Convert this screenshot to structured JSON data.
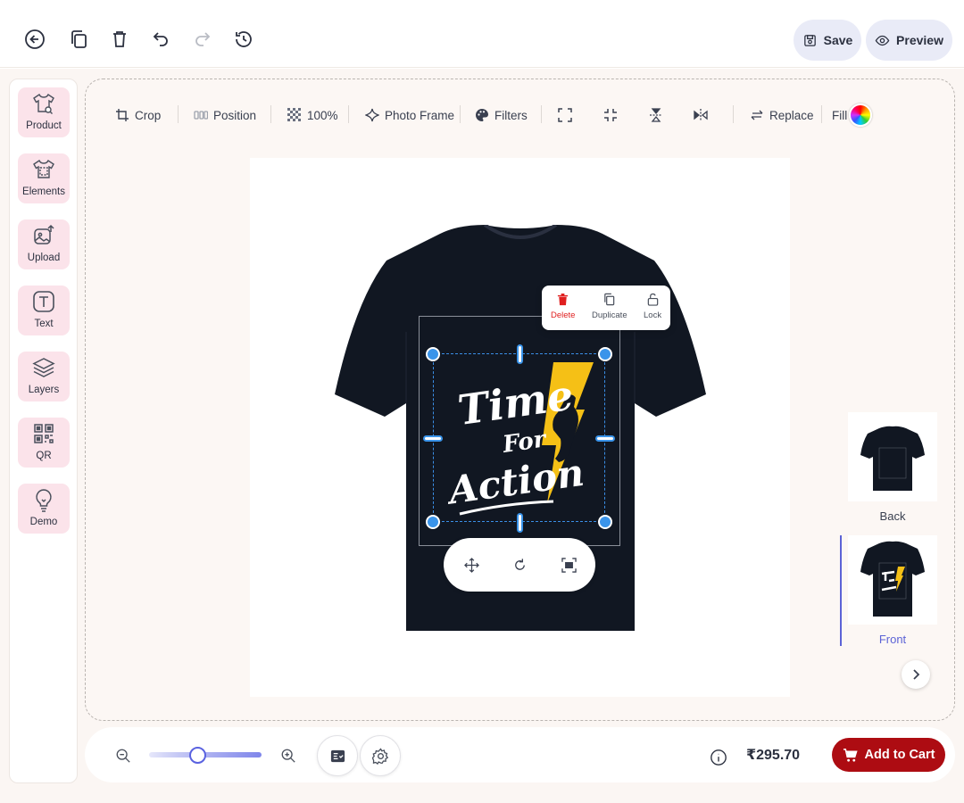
{
  "topbar": {
    "save_label": "Save",
    "preview_label": "Preview",
    "icons": [
      "back-icon",
      "copy-icon",
      "delete-icon",
      "undo-icon",
      "redo-icon",
      "history-icon"
    ]
  },
  "sidebar": {
    "items": [
      {
        "label": "Product",
        "icon": "tshirt-icon"
      },
      {
        "label": "Elements",
        "icon": "elements-icon"
      },
      {
        "label": "Upload",
        "icon": "upload-icon"
      },
      {
        "label": "Text",
        "icon": "text-icon"
      },
      {
        "label": "Layers",
        "icon": "layers-icon"
      },
      {
        "label": "QR",
        "icon": "qr-icon"
      },
      {
        "label": "Demo",
        "icon": "lightbulb-icon"
      }
    ]
  },
  "toolbar": {
    "crop": "Crop",
    "position": "Position",
    "opacity": "100%",
    "photo_frame": "Photo Frame",
    "filters": "Filters",
    "replace": "Replace",
    "fill": "Fill"
  },
  "context_menu": {
    "delete": "Delete",
    "duplicate": "Duplicate",
    "lock": "Lock"
  },
  "design": {
    "line1": "Time",
    "line2": "For",
    "line3": "Action"
  },
  "views": {
    "back": "Back",
    "front": "Front"
  },
  "bottombar": {
    "price": "₹295.70",
    "add_to_cart": "Add to Cart",
    "zoom_level": 0.4
  },
  "colors": {
    "accent": "#5c63d6",
    "cart": "#ad0c12",
    "delete": "#e02020",
    "handle": "#3a94ea",
    "shirt": "#111722",
    "bolt": "#f5c016"
  }
}
